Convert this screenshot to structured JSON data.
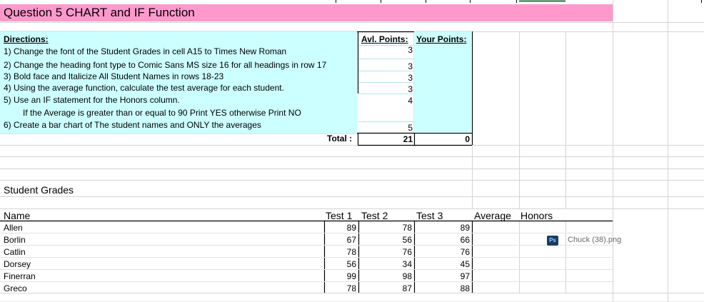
{
  "title": "Question 5 CHART and IF Function",
  "directions": {
    "heading": "Directions:",
    "lines": [
      "1) Change the font of the Student Grades in cell A15 to Times New Roman",
      "2) Change the heading font type to Comic Sans MS size 16 for all headings in row 17",
      "3) Bold face and Italicize All Student Names  in rows 18-23",
      "4) Using the average function, calculate the test average for each student.",
      "5) Use an IF statement for the Honors column.",
      "If the Average is greater than or equal to 90 Print YES otherwise Print NO",
      "6) Create a bar chart of The student names and ONLY the averages"
    ]
  },
  "points": {
    "avail_header": "Avl. Points:",
    "your_header": "Your Points:",
    "avail": [
      "3",
      "3",
      "3",
      "3",
      "4",
      "5"
    ],
    "total_label": "Total :",
    "total_avail": "21",
    "total_yours": "0"
  },
  "grades": {
    "section_title": "Student Grades",
    "headers": [
      "Name",
      "Test 1",
      "Test 2",
      "Test 3",
      "Average",
      "Honors"
    ],
    "rows": [
      {
        "name": "Allen",
        "t1": "89",
        "t2": "78",
        "t3": "89"
      },
      {
        "name": "Borlin",
        "t1": "67",
        "t2": "56",
        "t3": "66"
      },
      {
        "name": "Catlin",
        "t1": "78",
        "t2": "76",
        "t3": "76"
      },
      {
        "name": "Dorsey",
        "t1": "56",
        "t2": "34",
        "t3": "45"
      },
      {
        "name": "Finerran",
        "t1": "99",
        "t2": "98",
        "t3": "97"
      },
      {
        "name": "Greco",
        "t1": "78",
        "t2": "87",
        "t3": "88"
      }
    ]
  },
  "floating_file": {
    "icon_label": "Ps",
    "icon": "photoshop-icon",
    "name": "Chuck (38).png"
  },
  "colors": {
    "title_band": "#ff99cc",
    "directions_bg": "#ccffff",
    "gridline": "#d4d4d4"
  }
}
